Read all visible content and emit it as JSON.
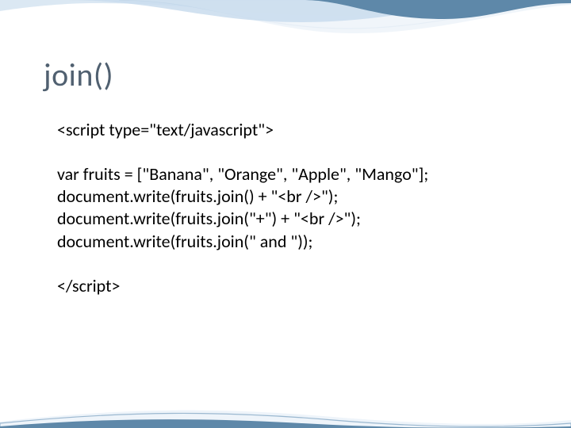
{
  "title": "join()",
  "code": {
    "l1": "<script type=\"text/javascript\">",
    "l2": "var fruits = [\"Banana\", \"Orange\", \"Apple\", \"Mango\"];",
    "l3": "document.write(fruits.join() + \"<br />\");",
    "l4": "document.write(fruits.join(\"+\") + \"<br />\");",
    "l5": "document.write(fruits.join(\" and \"));",
    "l6": "</script>"
  },
  "colors": {
    "title": "#506070",
    "swoosh_dark": "#7aa0c0",
    "swoosh_light": "#cde0ee"
  }
}
